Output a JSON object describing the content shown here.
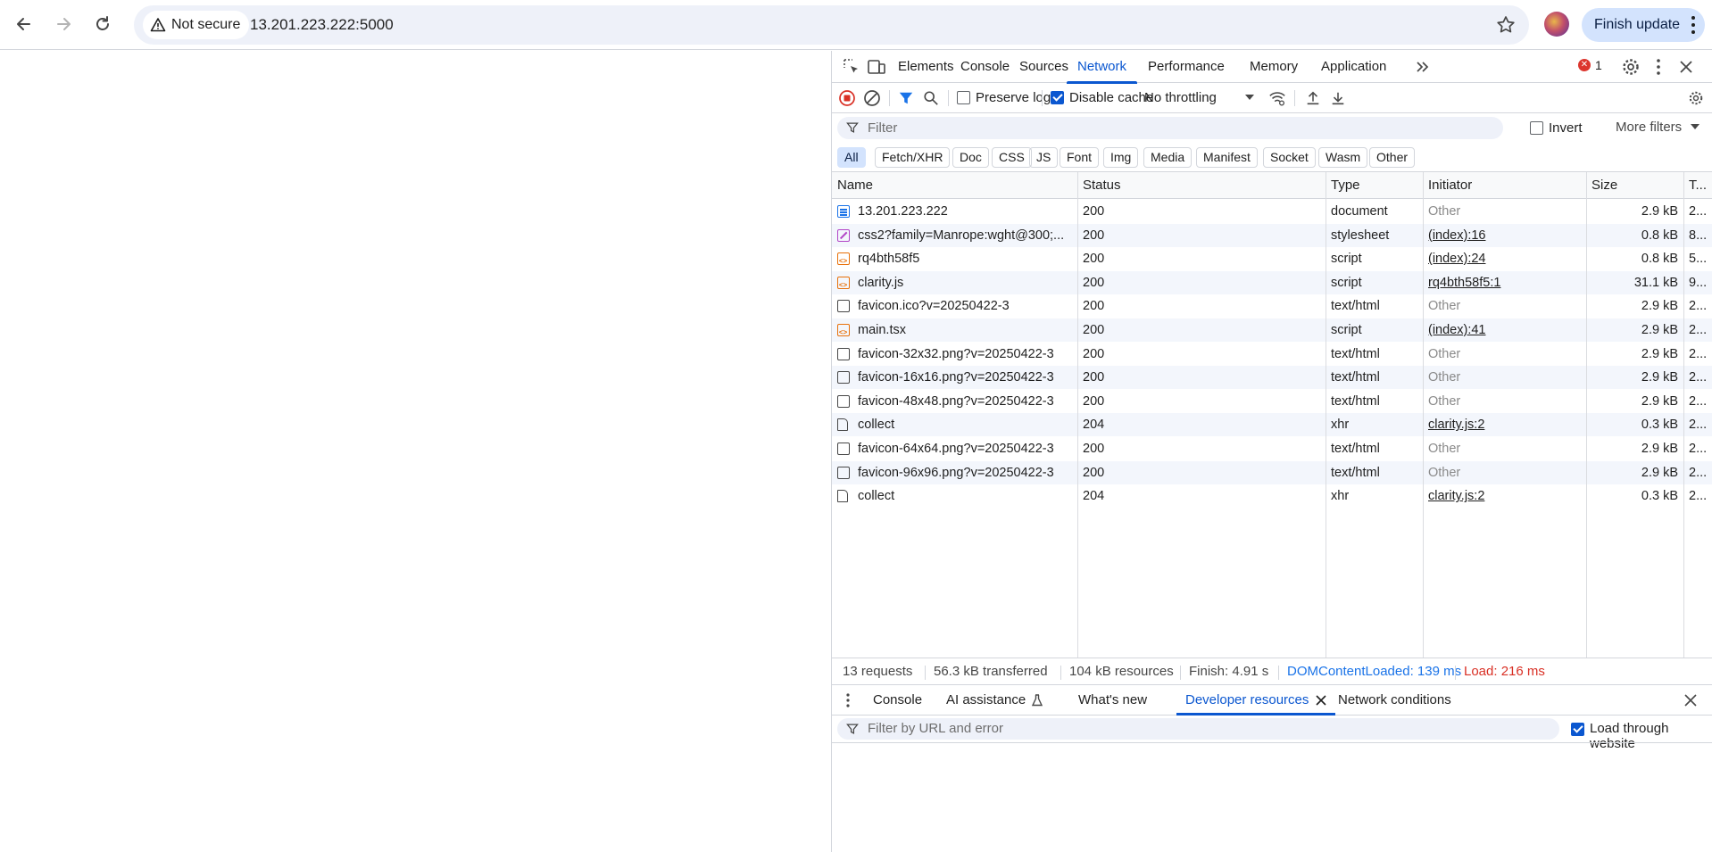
{
  "browser": {
    "security_label": "Not secure",
    "url": "13.201.223.222:5000",
    "finish_update_label": "Finish update"
  },
  "devtools": {
    "tabs": [
      "Elements",
      "Console",
      "Sources",
      "Network",
      "Performance",
      "Memory",
      "Application"
    ],
    "active_tab": "Network",
    "error_count": "1",
    "toolbar": {
      "preserve_log_label": "Preserve log",
      "preserve_log_checked": false,
      "disable_cache_label": "Disable cache",
      "disable_cache_checked": true,
      "throttling_value": "No throttling"
    },
    "filter": {
      "placeholder": "Filter",
      "invert_label": "Invert",
      "more_filters_label": "More filters"
    },
    "type_filters": [
      "All",
      "Fetch/XHR",
      "Doc",
      "CSS",
      "JS",
      "Font",
      "Img",
      "Media",
      "Manifest",
      "Socket",
      "Wasm",
      "Other"
    ],
    "active_type_filter": "All",
    "table": {
      "headers": {
        "name": "Name",
        "status": "Status",
        "type": "Type",
        "initiator": "Initiator",
        "size": "Size",
        "time": "T..."
      },
      "rows": [
        {
          "name": "13.201.223.222",
          "icon": "document-icon",
          "status": "200",
          "type": "document",
          "initiator": "Other",
          "size": "2.9 kB",
          "time": "2..."
        },
        {
          "name": "css2?family=Manrope:wght@300;...",
          "icon": "stylesheet-icon",
          "status": "200",
          "type": "stylesheet",
          "initiator": "(index):16",
          "size": "0.8 kB",
          "time": "8..."
        },
        {
          "name": "rq4bth58f5",
          "icon": "script-icon",
          "status": "200",
          "type": "script",
          "initiator": "(index):24",
          "size": "0.8 kB",
          "time": "5..."
        },
        {
          "name": "clarity.js",
          "icon": "script-icon",
          "status": "200",
          "type": "script",
          "initiator": "rq4bth58f5:1",
          "size": "31.1 kB",
          "time": "9..."
        },
        {
          "name": "favicon.ico?v=20250422-3",
          "icon": "generic-file-icon",
          "status": "200",
          "type": "text/html",
          "initiator": "Other",
          "size": "2.9 kB",
          "time": "2..."
        },
        {
          "name": "main.tsx",
          "icon": "script-icon",
          "status": "200",
          "type": "script",
          "initiator": "(index):41",
          "size": "2.9 kB",
          "time": "2..."
        },
        {
          "name": "favicon-32x32.png?v=20250422-3",
          "icon": "generic-file-icon",
          "status": "200",
          "type": "text/html",
          "initiator": "Other",
          "size": "2.9 kB",
          "time": "2..."
        },
        {
          "name": "favicon-16x16.png?v=20250422-3",
          "icon": "generic-file-icon",
          "status": "200",
          "type": "text/html",
          "initiator": "Other",
          "size": "2.9 kB",
          "time": "2..."
        },
        {
          "name": "favicon-48x48.png?v=20250422-3",
          "icon": "generic-file-icon",
          "status": "200",
          "type": "text/html",
          "initiator": "Other",
          "size": "2.9 kB",
          "time": "2..."
        },
        {
          "name": "collect",
          "icon": "fetch-icon",
          "status": "204",
          "type": "xhr",
          "initiator": "clarity.js:2",
          "size": "0.3 kB",
          "time": "2..."
        },
        {
          "name": "favicon-64x64.png?v=20250422-3",
          "icon": "generic-file-icon",
          "status": "200",
          "type": "text/html",
          "initiator": "Other",
          "size": "2.9 kB",
          "time": "2..."
        },
        {
          "name": "favicon-96x96.png?v=20250422-3",
          "icon": "generic-file-icon",
          "status": "200",
          "type": "text/html",
          "initiator": "Other",
          "size": "2.9 kB",
          "time": "2..."
        },
        {
          "name": "collect",
          "icon": "fetch-icon",
          "status": "204",
          "type": "xhr",
          "initiator": "clarity.js:2",
          "size": "0.3 kB",
          "time": "2..."
        }
      ]
    },
    "summary": {
      "requests": "13 requests",
      "transferred": "56.3 kB transferred",
      "resources": "104 kB resources",
      "finish": "Finish: 4.91 s",
      "dom_content_loaded": "DOMContentLoaded: 139 ms",
      "load": "Load: 216 ms"
    },
    "drawer": {
      "tabs": [
        "Console",
        "AI assistance",
        "What's new",
        "Developer resources",
        "Network conditions"
      ],
      "active_tab": "Developer resources",
      "filter_placeholder": "Filter by URL and error",
      "load_through_website_label": "Load through website",
      "load_through_website_checked": true
    }
  },
  "colors": {
    "accent": "#0b57d0",
    "dom_content_loaded": "#1a73e8",
    "load": "#d93025",
    "error": "#dc362e"
  }
}
